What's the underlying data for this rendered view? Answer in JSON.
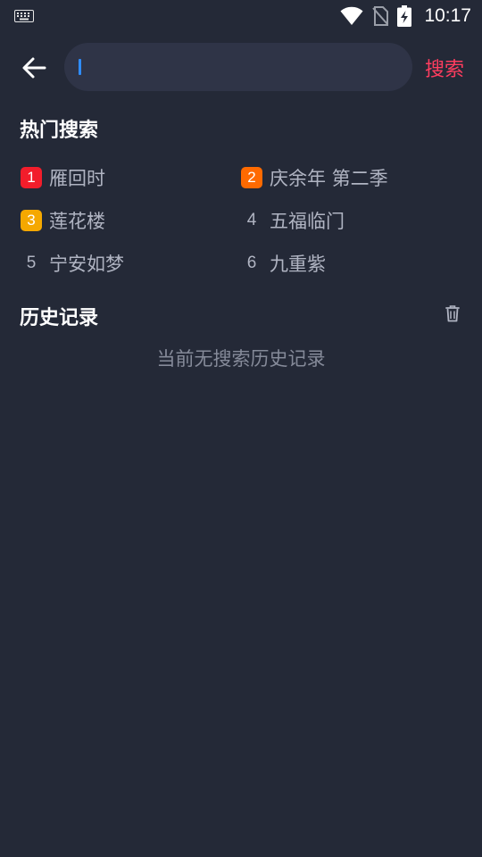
{
  "status_bar": {
    "time": "10:17",
    "icons": [
      "keyboard-icon",
      "wifi-icon",
      "no-sim-icon",
      "battery-charging-icon"
    ]
  },
  "search": {
    "value": "",
    "placeholder": "",
    "submit_label": "搜索",
    "accent_color": "#ff3d5f",
    "caret_color": "#2f8cff"
  },
  "hot_search": {
    "title": "热门搜索",
    "items": [
      {
        "rank": "1",
        "label": "雁回时",
        "badge_color": "#f21d2b"
      },
      {
        "rank": "2",
        "label": "庆余年 第二季",
        "badge_color": "#ff6a00"
      },
      {
        "rank": "3",
        "label": "莲花楼",
        "badge_color": "#f5a800"
      },
      {
        "rank": "4",
        "label": "五福临门",
        "badge_color": ""
      },
      {
        "rank": "5",
        "label": "宁安如梦",
        "badge_color": ""
      },
      {
        "rank": "6",
        "label": "九重紫",
        "badge_color": ""
      }
    ]
  },
  "history": {
    "title": "历史记录",
    "empty_text": "当前无搜索历史记录",
    "clear_icon": "trash-icon"
  },
  "colors": {
    "background": "#242937",
    "search_box": "#2f3447"
  }
}
